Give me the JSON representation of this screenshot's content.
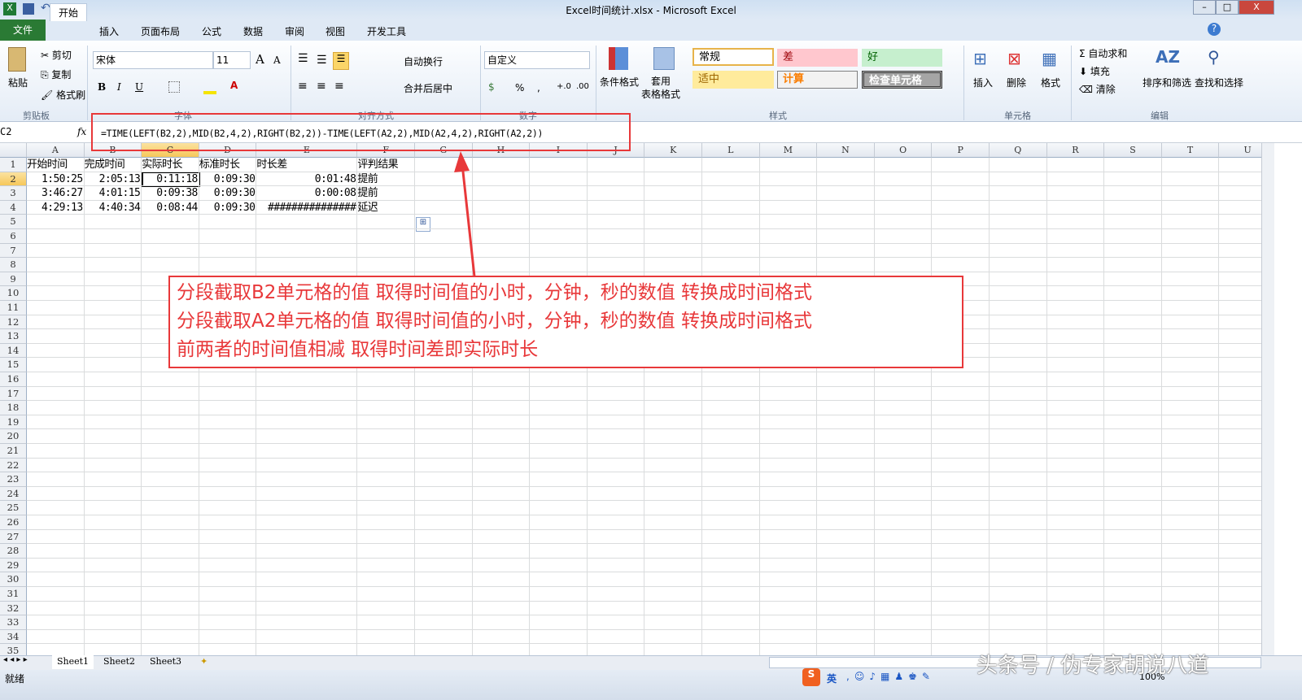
{
  "window": {
    "title": "Excel时间统计.xlsx - Microsoft Excel",
    "min": "–",
    "max": "□",
    "close": "X"
  },
  "tabs": [
    "文件",
    "开始",
    "插入",
    "页面布局",
    "公式",
    "数据",
    "审阅",
    "视图",
    "开发工具"
  ],
  "ribbon": {
    "clipboard": {
      "paste": "粘贴",
      "cut": "剪切",
      "copy": "复制",
      "format_painter": "格式刷",
      "label": "剪贴板"
    },
    "font": {
      "name": "宋体",
      "size": "11",
      "bold": "B",
      "italic": "I",
      "underline": "U",
      "grow": "A",
      "shrink": "A",
      "label": "字体"
    },
    "alignment": {
      "wrap": "自动换行",
      "merge": "合并后居中",
      "label": "对齐方式"
    },
    "number": {
      "format": "自定义",
      "percent": "%",
      "comma": ",",
      "inc": "+.0",
      "dec": ".00",
      "label": "数字"
    },
    "styles": {
      "conditional": "条件格式",
      "table": "套用\n表格格式",
      "items": [
        "常规",
        "差",
        "好",
        "适中",
        "计算",
        "检查单元格"
      ],
      "label": "样式"
    },
    "cells": {
      "insert": "插入",
      "delete": "删除",
      "format": "格式",
      "label": "单元格"
    },
    "editing": {
      "autosum": "自动求和",
      "fill": "填充",
      "clear": "清除",
      "sort": "排序和筛选",
      "find": "查找和选择",
      "label": "编辑"
    }
  },
  "formula_bar": {
    "name_box": "C2",
    "fx": "fx",
    "formula": "=TIME(LEFT(B2,2),MID(B2,4,2),RIGHT(B2,2))-TIME(LEFT(A2,2),MID(A2,4,2),RIGHT(A2,2))"
  },
  "columns": [
    "A",
    "B",
    "C",
    "D",
    "E",
    "F",
    "G",
    "H",
    "I",
    "J",
    "K",
    "L",
    "M",
    "N",
    "O",
    "P",
    "Q",
    "R",
    "S",
    "T",
    "U"
  ],
  "rows_count": 35,
  "table": {
    "header": [
      "开始时间",
      "完成时间",
      "实际时长",
      "标准时长",
      "时长差",
      "评判结果"
    ],
    "rows": [
      [
        "1:50:25",
        "2:05:13",
        "0:11:18",
        "0:09:30",
        "0:01:48",
        "提前"
      ],
      [
        "3:46:27",
        "4:01:15",
        "0:09:38",
        "0:09:30",
        "0:00:08",
        "提前"
      ],
      [
        "4:29:13",
        "4:40:34",
        "0:08:44",
        "0:09:30",
        "###############",
        "延迟"
      ]
    ]
  },
  "annotation": [
    "分段截取B2单元格的值 取得时间值的小时，分钟，秒的数值 转换成时间格式",
    "分段截取A2单元格的值 取得时间值的小时，分钟，秒的数值 转换成时间格式",
    "前两者的时间值相减 取得时间差即实际时长"
  ],
  "sheets": [
    "Sheet1",
    "Sheet2",
    "Sheet3"
  ],
  "status": {
    "ready": "就绪",
    "zoom": "100%",
    "ime": "英"
  },
  "watermark": "头条号 / 伪专家胡说八道"
}
